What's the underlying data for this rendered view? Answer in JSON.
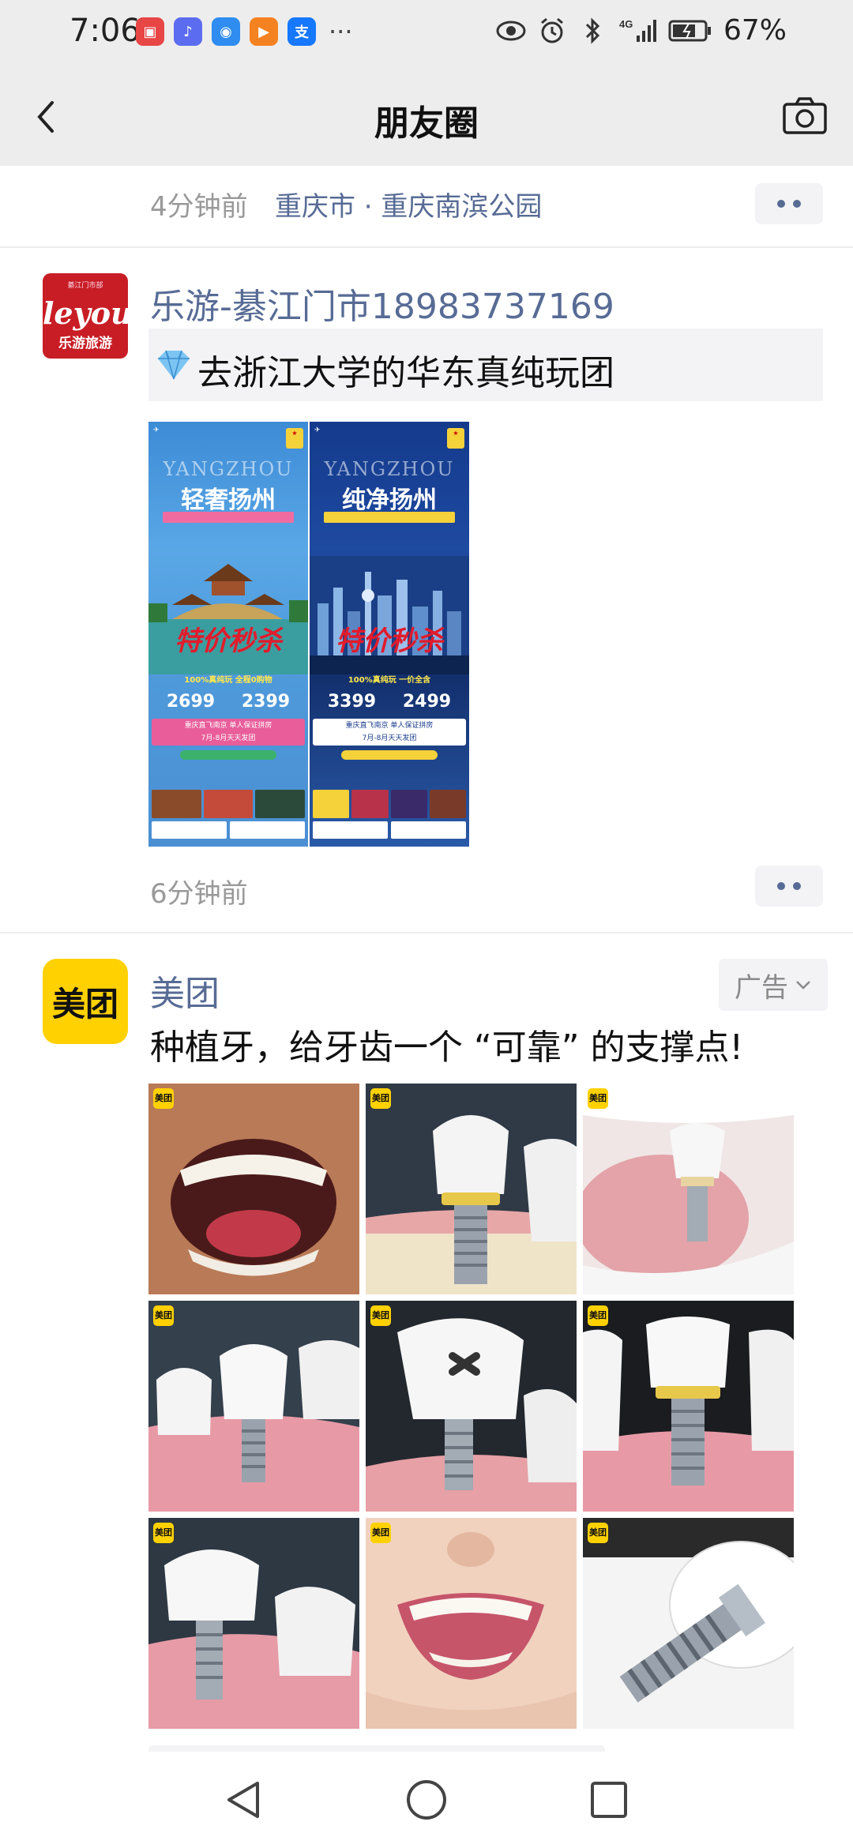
{
  "status_bar": {
    "time": "7:06",
    "more_apps": "···",
    "battery": "67%",
    "network": "4G"
  },
  "nav": {
    "title": "朋友圈"
  },
  "prev_post": {
    "time": "4分钟前",
    "location": "重庆市 · 重庆南滨公园"
  },
  "post1": {
    "author": "乐游-綦江门市18983737169",
    "avatar": {
      "small": "綦江门市部",
      "logo": "leyou",
      "name": "乐游旅游"
    },
    "shared_title": "去浙江大学的华东真纯玩团",
    "posters": [
      {
        "en": "YANGZHOU",
        "title": "轻奢扬州",
        "red": "特价秒杀",
        "yellow": "100%真纯玩 全程0购物",
        "price1": "2699",
        "price2": "2399",
        "box_line1": "重庆直飞南京 单人保证拼房",
        "box_line2": "7月-8月天天发团"
      },
      {
        "en": "YANGZHOU",
        "title": "纯净扬州",
        "red": "特价秒杀",
        "yellow": "100%真纯玩 一价全含",
        "price1": "3399",
        "price2": "2499",
        "box_line1": "重庆直飞南京 单人保证拼房",
        "box_line2": "7月-8月天天发团"
      }
    ],
    "time": "6分钟前"
  },
  "ad_post": {
    "author": "美团",
    "avatar_text": "美团",
    "ad_label": "广告",
    "text": "种植牙，给牙齿一个 “可靠” 的支撑点!",
    "badge": "美团",
    "images": [
      {
        "name": "smile-photo"
      },
      {
        "name": "implant-crown-render"
      },
      {
        "name": "implant-in-jaw-render"
      },
      {
        "name": "implant-pink-gum-render"
      },
      {
        "name": "crown-x-mark-render"
      },
      {
        "name": "implant-gold-ring-render"
      },
      {
        "name": "implant-side-render"
      },
      {
        "name": "woman-smile-photo"
      },
      {
        "name": "screw-closeup-render"
      }
    ]
  },
  "colors": {
    "link_blue": "#576b95",
    "meituan_yellow": "#ffd100",
    "header_bg": "#ededed"
  }
}
